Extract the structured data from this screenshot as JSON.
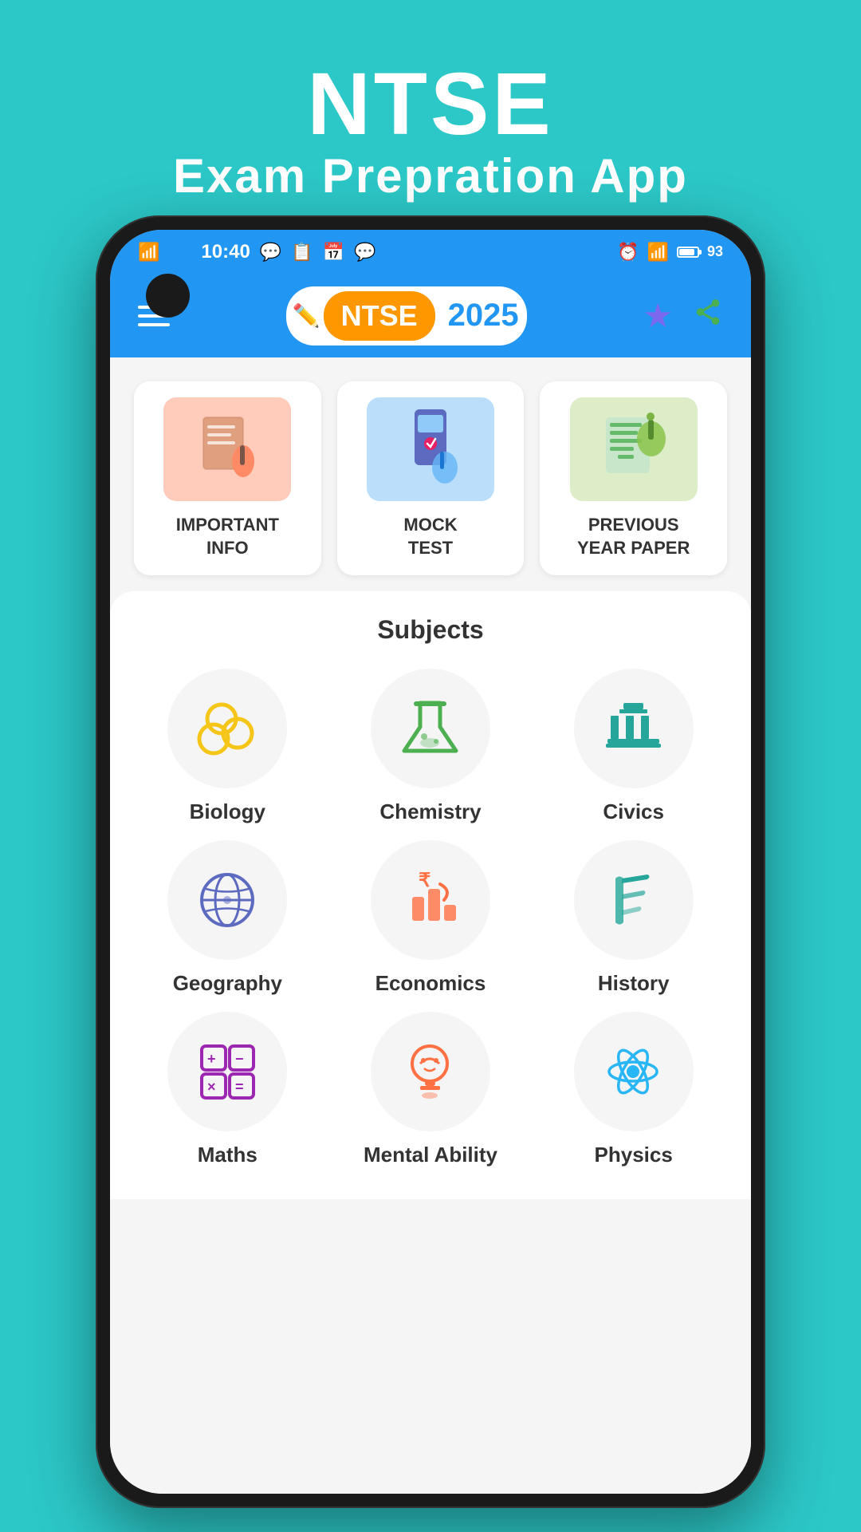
{
  "background_color": "#2CC7C7",
  "header": {
    "title": "NTSE",
    "subtitle": "Exam Prepration App"
  },
  "status_bar": {
    "time": "10:40",
    "battery": "93"
  },
  "app_header": {
    "logo_ntse": "NTSE",
    "logo_year": "2025",
    "hamburger_label": "Menu",
    "star_label": "Favorites",
    "share_label": "Share"
  },
  "cards": [
    {
      "label": "IMPORTANT\nINFO",
      "icon": "📋",
      "color": "pink"
    },
    {
      "label": "MOCK\nTEST",
      "icon": "📱",
      "color": "blue"
    },
    {
      "label": "PREVIOUS\nYEAR PAPER",
      "icon": "📝",
      "color": "green"
    }
  ],
  "subjects_section": {
    "title": "Subjects",
    "items": [
      {
        "name": "Biology",
        "icon_class": "icon-biology",
        "unicode": "⬡"
      },
      {
        "name": "Chemistry",
        "icon_class": "icon-chemistry",
        "unicode": "⚗"
      },
      {
        "name": "Civics",
        "icon_class": "icon-civics",
        "unicode": "🏛"
      },
      {
        "name": "Geography",
        "icon_class": "icon-geography",
        "unicode": "🌏"
      },
      {
        "name": "Economics",
        "icon_class": "icon-economics",
        "unicode": "₹"
      },
      {
        "name": "History",
        "icon_class": "icon-history",
        "unicode": "📜"
      },
      {
        "name": "Maths",
        "icon_class": "icon-maths",
        "unicode": "🔢"
      },
      {
        "name": "Mental Ability",
        "icon_class": "icon-mental",
        "unicode": "🧠"
      },
      {
        "name": "Physics",
        "icon_class": "icon-physics",
        "unicode": "⚛"
      }
    ]
  }
}
